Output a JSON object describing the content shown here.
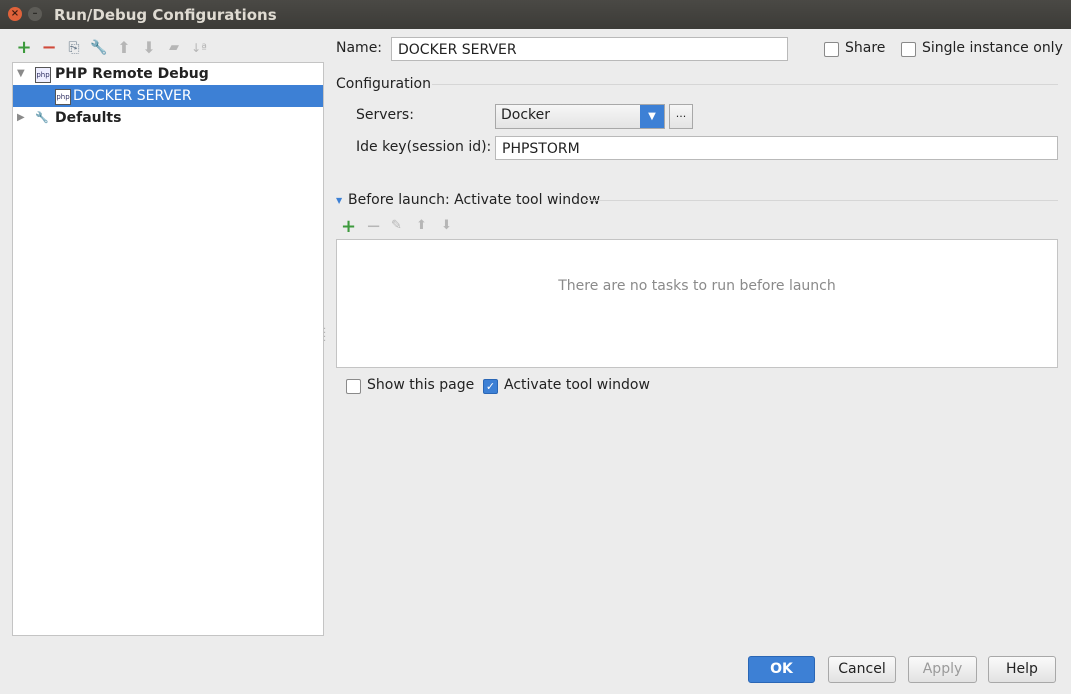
{
  "window": {
    "title": "Run/Debug Configurations"
  },
  "toolbar": {
    "add": "+",
    "remove": "−",
    "copy": "⎘",
    "edit": "🔧",
    "up": "⬆",
    "down": "⬇",
    "folder": "▰",
    "sort": "↓ª"
  },
  "tree": {
    "group_label": "PHP Remote Debug",
    "selected_item": "DOCKER SERVER",
    "defaults_label": "Defaults"
  },
  "form": {
    "name_label": "Name:",
    "name_value": "DOCKER SERVER",
    "share_label": "Share",
    "single_instance_label": "Single instance only",
    "configuration_heading": "Configuration",
    "servers_label": "Servers:",
    "servers_value": "Docker",
    "browse_label": "...",
    "idekey_label": "Ide key(session id):",
    "idekey_value": "PHPSTORM",
    "before_launch_heading": "Before launch: Activate tool window",
    "empty_tasks": "There are no tasks to run before launch",
    "show_page_label": "Show this page",
    "activate_tool_label": "Activate tool window"
  },
  "buttons": {
    "ok": "OK",
    "cancel": "Cancel",
    "apply": "Apply",
    "help": "Help"
  }
}
